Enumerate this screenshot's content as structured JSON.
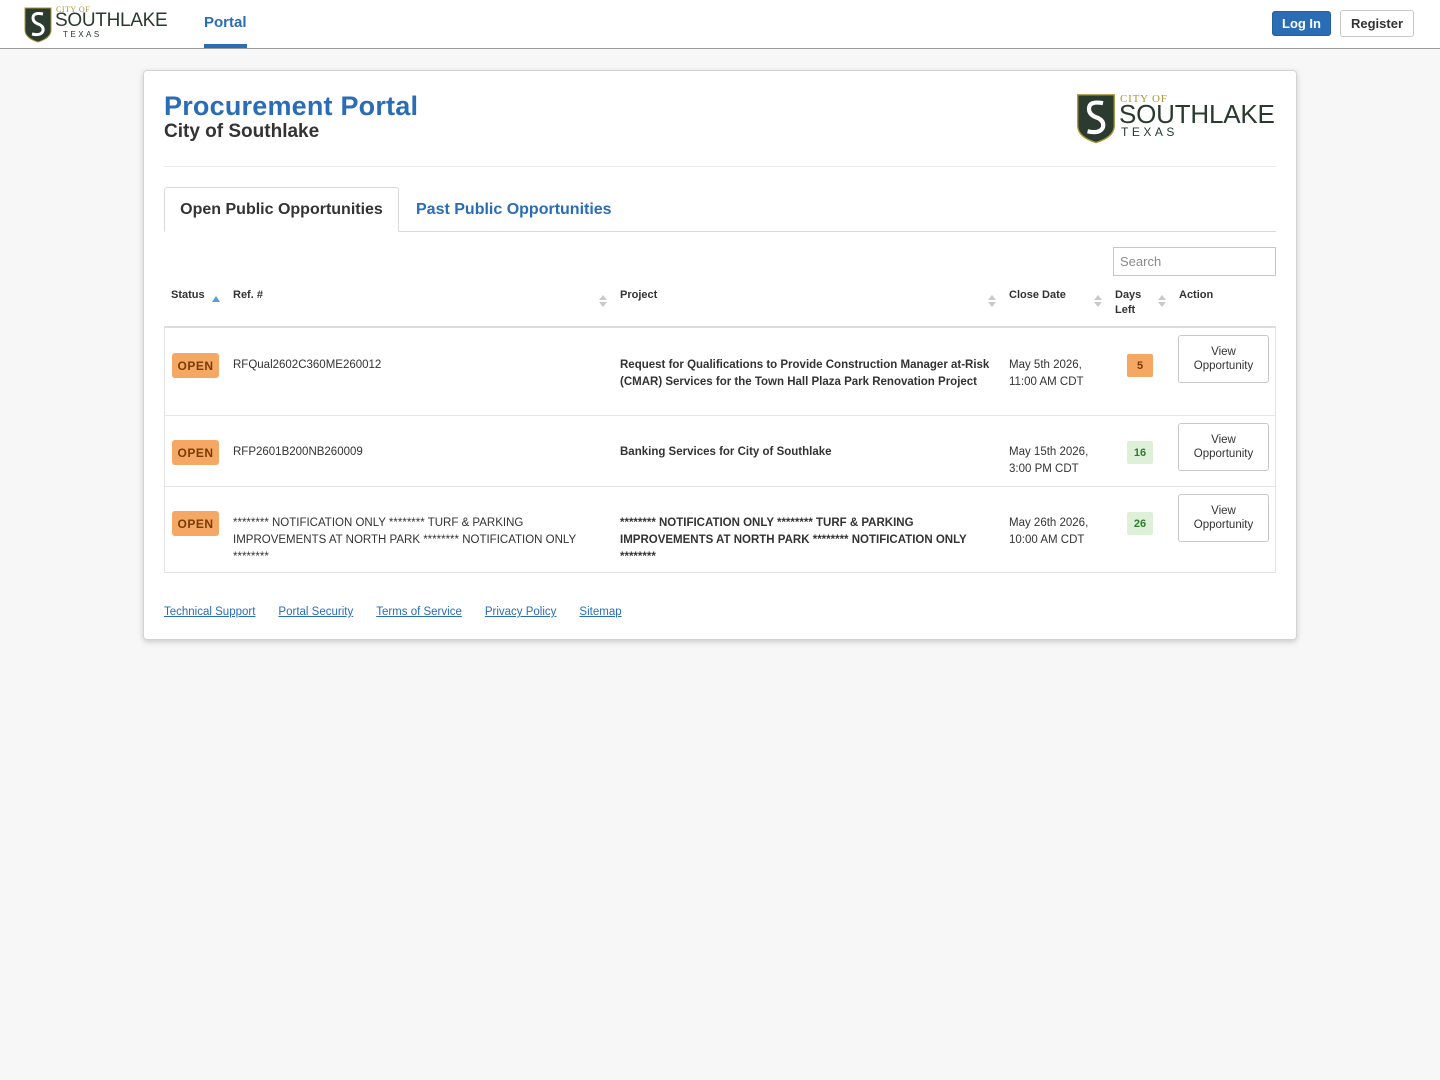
{
  "header": {
    "logo": {
      "city": "CITY OF",
      "name": "SOUTHLAKE",
      "state": "TEXAS"
    },
    "nav_portal": "Portal",
    "login": "Log In",
    "register": "Register"
  },
  "page": {
    "title": "Procurement Portal",
    "subtitle": "City of Southlake",
    "logo": {
      "city": "CITY OF",
      "name": "SOUTHLAKE",
      "state": "TEXAS"
    }
  },
  "tabs": {
    "open": "Open Public Opportunities",
    "past": "Past Public Opportunities"
  },
  "search": {
    "placeholder": "Search",
    "value": ""
  },
  "table": {
    "headers": {
      "status": "Status",
      "ref": "Ref. #",
      "project": "Project",
      "close_date": "Close Date",
      "days_left_1": "Days",
      "days_left_2": "Left",
      "action": "Action"
    },
    "rows": [
      {
        "status": "OPEN",
        "ref": "RFQual2602C360ME260012",
        "project": "Request for Qualifications to Provide Construction Manager at-Risk (CMAR) Services for the Town Hall Plaza Park Renovation Project",
        "close_date_1": "May 5th 2026,",
        "close_date_2": "11:00 AM CDT",
        "days_left": "5",
        "days_color": "orange",
        "action_1": "View",
        "action_2": "Opportunity"
      },
      {
        "status": "OPEN",
        "ref": "RFP2601B200NB260009",
        "project": "Banking Services for City of Southlake",
        "close_date_1": "May 15th 2026,",
        "close_date_2": "3:00 PM CDT",
        "days_left": "16",
        "days_color": "green",
        "action_1": "View",
        "action_2": "Opportunity"
      },
      {
        "status": "OPEN",
        "ref": "******** NOTIFICATION ONLY ******** TURF & PARKING IMPROVEMENTS AT NORTH PARK ******** NOTIFICATION ONLY ********",
        "project": "******** NOTIFICATION ONLY ******** TURF & PARKING IMPROVEMENTS AT NORTH PARK ******** NOTIFICATION ONLY ********",
        "close_date_1": "May 26th 2026,",
        "close_date_2": "10:00 AM CDT",
        "days_left": "26",
        "days_color": "green",
        "action_1": "View",
        "action_2": "Opportunity"
      }
    ]
  },
  "footer": {
    "links": [
      "Technical Support",
      "Portal Security",
      "Terms of Service",
      "Privacy Policy",
      "Sitemap"
    ]
  },
  "colors": {
    "primary": "#2a6db5",
    "open_badge": "#f5a863",
    "days_orange": "#f5a863",
    "days_green": "#dff0d8"
  }
}
